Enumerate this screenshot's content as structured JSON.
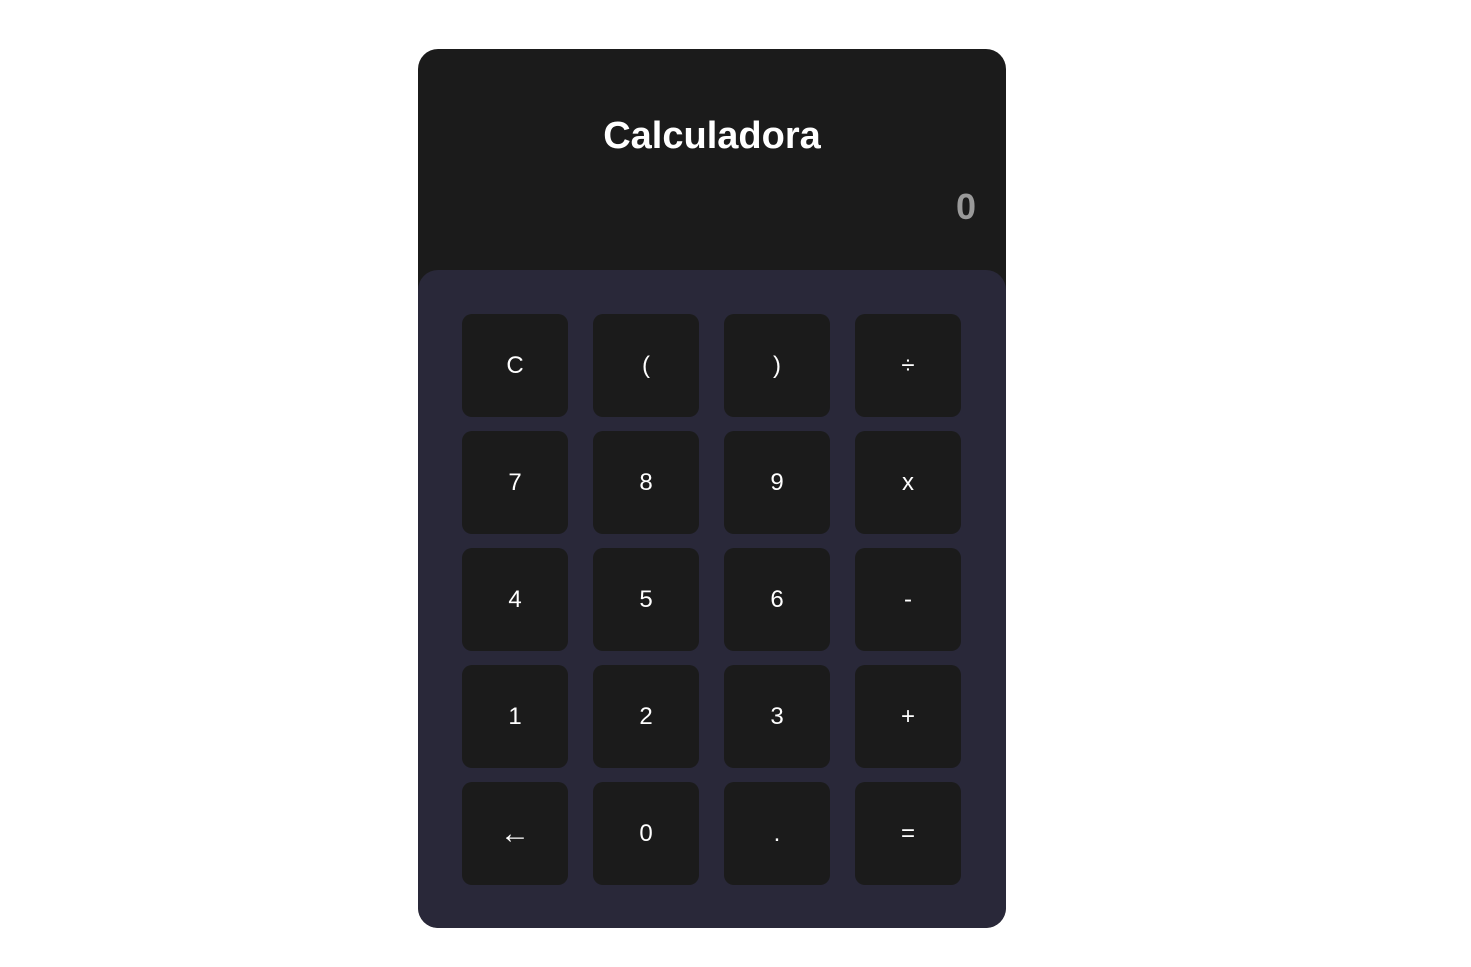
{
  "app": {
    "title": "Calculadora"
  },
  "display": {
    "value": "0"
  },
  "keys": [
    {
      "label": "C",
      "name": "clear-button"
    },
    {
      "label": "(",
      "name": "open-paren-button"
    },
    {
      "label": ")",
      "name": "close-paren-button"
    },
    {
      "label": "÷",
      "name": "divide-button"
    },
    {
      "label": "7",
      "name": "digit-7-button"
    },
    {
      "label": "8",
      "name": "digit-8-button"
    },
    {
      "label": "9",
      "name": "digit-9-button"
    },
    {
      "label": "x",
      "name": "multiply-button"
    },
    {
      "label": "4",
      "name": "digit-4-button"
    },
    {
      "label": "5",
      "name": "digit-5-button"
    },
    {
      "label": "6",
      "name": "digit-6-button"
    },
    {
      "label": "-",
      "name": "subtract-button"
    },
    {
      "label": "1",
      "name": "digit-1-button"
    },
    {
      "label": "2",
      "name": "digit-2-button"
    },
    {
      "label": "3",
      "name": "digit-3-button"
    },
    {
      "label": "+",
      "name": "add-button"
    },
    {
      "label": "←",
      "name": "backspace-button"
    },
    {
      "label": "0",
      "name": "digit-0-button"
    },
    {
      "label": ".",
      "name": "decimal-button"
    },
    {
      "label": "=",
      "name": "equals-button"
    }
  ],
  "colors": {
    "panel": "#1b1b1b",
    "keypad": "#292839",
    "key": "#1b1b1b",
    "title_text": "#ffffff",
    "display_text": "#9a9a9a"
  }
}
